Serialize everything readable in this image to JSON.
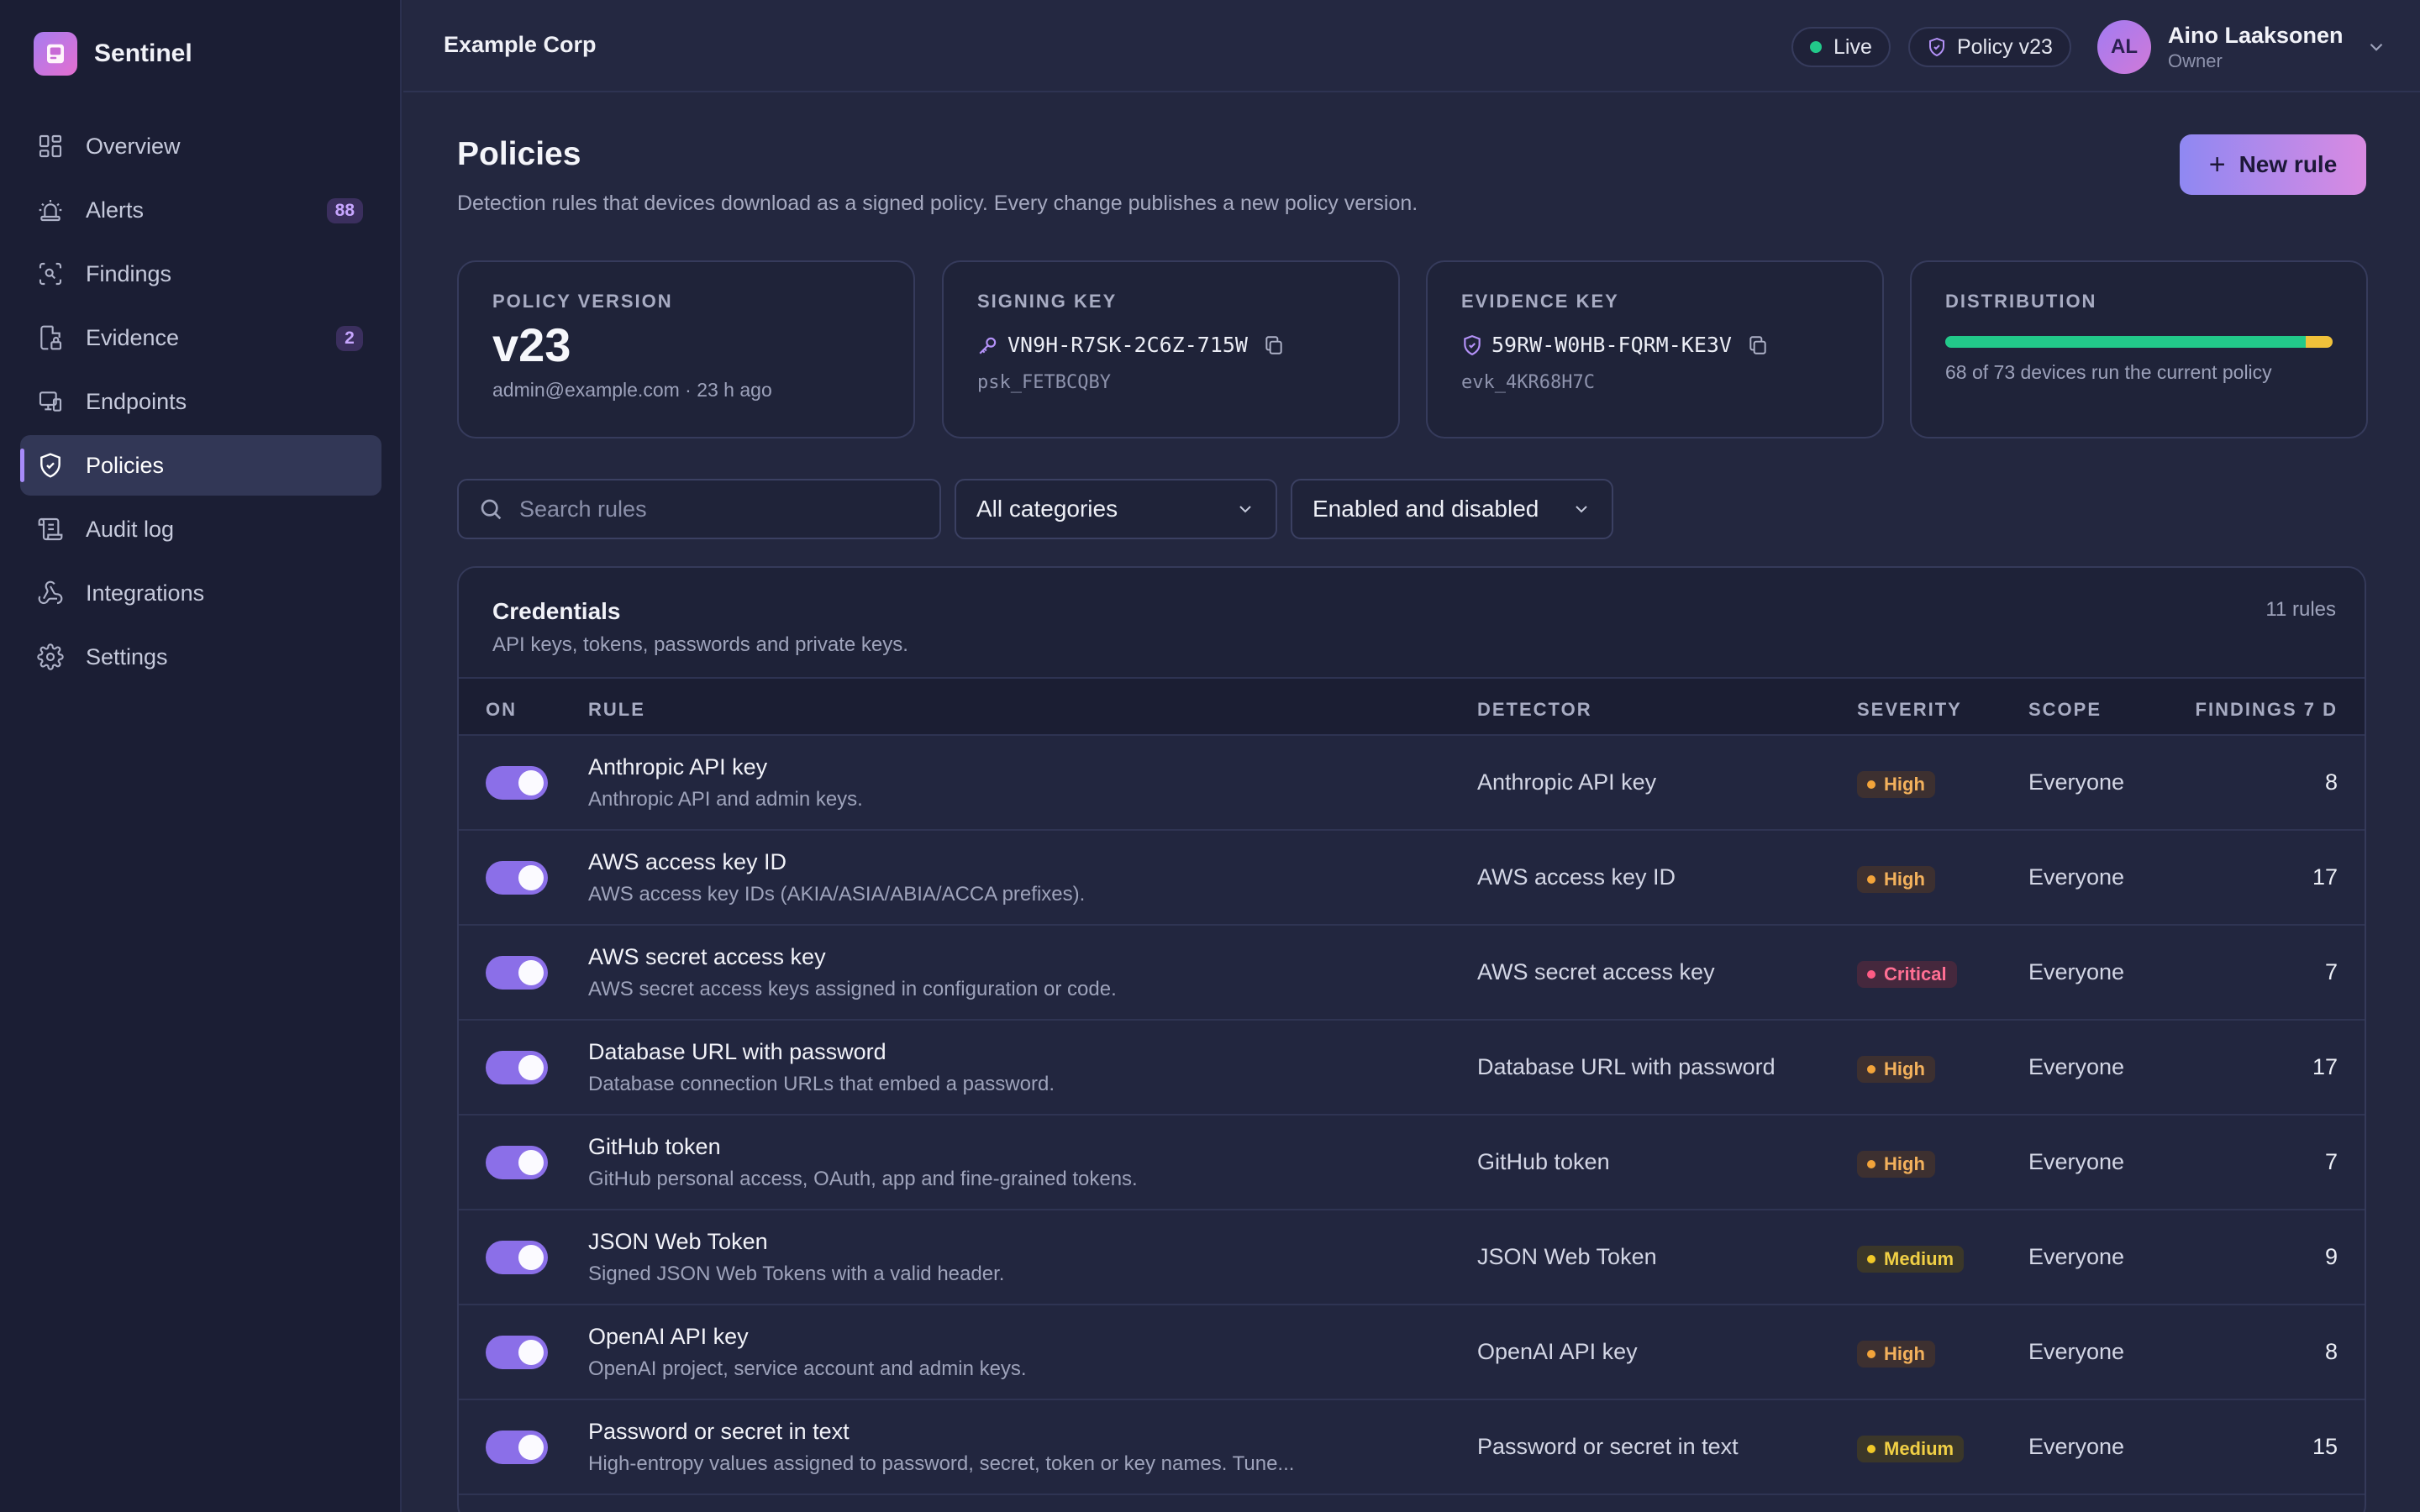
{
  "app": {
    "name": "Sentinel"
  },
  "sidebar": {
    "items": [
      {
        "label": "Overview",
        "icon": "grid-icon",
        "badge": ""
      },
      {
        "label": "Alerts",
        "icon": "siren-icon",
        "badge": "88"
      },
      {
        "label": "Findings",
        "icon": "scan-icon",
        "badge": ""
      },
      {
        "label": "Evidence",
        "icon": "file-lock-icon",
        "badge": "2"
      },
      {
        "label": "Endpoints",
        "icon": "monitor-icon",
        "badge": ""
      },
      {
        "label": "Policies",
        "icon": "shield-check-icon",
        "badge": "",
        "active": true
      },
      {
        "label": "Audit log",
        "icon": "scroll-icon",
        "badge": ""
      },
      {
        "label": "Integrations",
        "icon": "webhook-icon",
        "badge": ""
      },
      {
        "label": "Settings",
        "icon": "gear-icon",
        "badge": ""
      }
    ]
  },
  "topbar": {
    "org": "Example Corp",
    "live_label": "Live",
    "policy_label": "Policy v23",
    "user": {
      "initials": "AL",
      "name": "Aino Laaksonen",
      "role": "Owner"
    }
  },
  "page": {
    "title": "Policies",
    "subtitle": "Detection rules that devices download as a signed policy. Every change publishes a new policy version.",
    "new_rule_label": "New rule"
  },
  "cards": {
    "version": {
      "label": "POLICY VERSION",
      "value": "v23",
      "meta": "admin@example.com · 23 h ago"
    },
    "signing": {
      "label": "SIGNING KEY",
      "key": "VN9H-R7SK-2C6Z-715W",
      "sub": "psk_FETBCQBY"
    },
    "evidence": {
      "label": "EVIDENCE KEY",
      "key": "59RW-W0HB-FQRM-KE3V",
      "sub": "evk_4KR68H7C"
    },
    "distribution": {
      "label": "DISTRIBUTION",
      "current": 68,
      "total": 73,
      "text": "68 of 73 devices run the current policy"
    }
  },
  "filters": {
    "search_placeholder": "Search rules",
    "category": "All categories",
    "state": "Enabled and disabled"
  },
  "group": {
    "title": "Credentials",
    "subtitle": "API keys, tokens, passwords and private keys.",
    "count": "11 rules",
    "columns": {
      "on": "ON",
      "rule": "RULE",
      "detector": "DETECTOR",
      "severity": "SEVERITY",
      "scope": "SCOPE",
      "findings": "FINDINGS 7 D"
    },
    "rows": [
      {
        "name": "Anthropic API key",
        "desc": "Anthropic API and admin keys.",
        "detector": "Anthropic API key",
        "severity": "High",
        "scope": "Everyone",
        "findings": "8",
        "enabled": true
      },
      {
        "name": "AWS access key ID",
        "desc": "AWS access key IDs (AKIA/ASIA/ABIA/ACCA prefixes).",
        "detector": "AWS access key ID",
        "severity": "High",
        "scope": "Everyone",
        "findings": "17",
        "enabled": true
      },
      {
        "name": "AWS secret access key",
        "desc": "AWS secret access keys assigned in configuration or code.",
        "detector": "AWS secret access key",
        "severity": "Critical",
        "scope": "Everyone",
        "findings": "7",
        "enabled": true
      },
      {
        "name": "Database URL with password",
        "desc": "Database connection URLs that embed a password.",
        "detector": "Database URL with password",
        "severity": "High",
        "scope": "Everyone",
        "findings": "17",
        "enabled": true
      },
      {
        "name": "GitHub token",
        "desc": "GitHub personal access, OAuth, app and fine-grained tokens.",
        "detector": "GitHub token",
        "severity": "High",
        "scope": "Everyone",
        "findings": "7",
        "enabled": true
      },
      {
        "name": "JSON Web Token",
        "desc": "Signed JSON Web Tokens with a valid header.",
        "detector": "JSON Web Token",
        "severity": "Medium",
        "scope": "Everyone",
        "findings": "9",
        "enabled": true
      },
      {
        "name": "OpenAI API key",
        "desc": "OpenAI project, service account and admin keys.",
        "detector": "OpenAI API key",
        "severity": "High",
        "scope": "Everyone",
        "findings": "8",
        "enabled": true
      },
      {
        "name": "Password or secret in text",
        "desc": "High-entropy values assigned to password, secret, token or key names. Tune...",
        "detector": "Password or secret in text",
        "severity": "Medium",
        "scope": "Everyone",
        "findings": "15",
        "enabled": true
      }
    ]
  },
  "colors": {
    "accent": "#a78bfa",
    "live": "#22c98a",
    "high": "#f3a43a",
    "critical": "#ff5b84",
    "medium": "#f1c928"
  }
}
